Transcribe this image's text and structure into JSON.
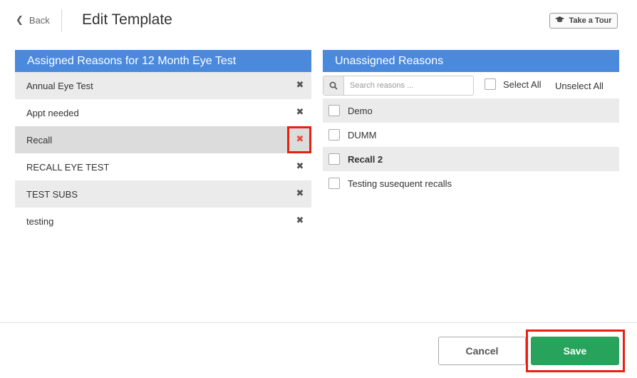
{
  "header": {
    "back_label": "Back",
    "title": "Edit Template",
    "tour_label": "Take a Tour"
  },
  "assigned": {
    "heading": "Assigned Reasons for 12 Month Eye Test",
    "items": [
      {
        "label": "Annual Eye Test"
      },
      {
        "label": "Appt needed"
      },
      {
        "label": "Recall"
      },
      {
        "label": "RECALL EYE TEST"
      },
      {
        "label": "TEST SUBS"
      },
      {
        "label": "testing"
      }
    ],
    "remove_glyph": "✖"
  },
  "unassigned": {
    "heading": "Unassigned Reasons",
    "search_placeholder": "Search reasons ...",
    "select_all_label": "Select All",
    "unselect_all_label": "Unselect All",
    "items": [
      {
        "label": "Demo",
        "checked": false
      },
      {
        "label": "DUMM",
        "checked": false
      },
      {
        "label": "Recall 2",
        "checked": false
      },
      {
        "label": "Testing susequent recalls",
        "checked": false
      }
    ]
  },
  "footer": {
    "cancel_label": "Cancel",
    "save_label": "Save"
  },
  "colors": {
    "header_blue": "#4a89dc",
    "save_green": "#27a35b",
    "highlight_red": "#e8210f",
    "remove_active_red": "#e74c3c"
  },
  "icons": {
    "back": "chevron-left-icon",
    "tour": "graduation-cap-icon",
    "search": "search-icon",
    "remove": "close-icon"
  }
}
